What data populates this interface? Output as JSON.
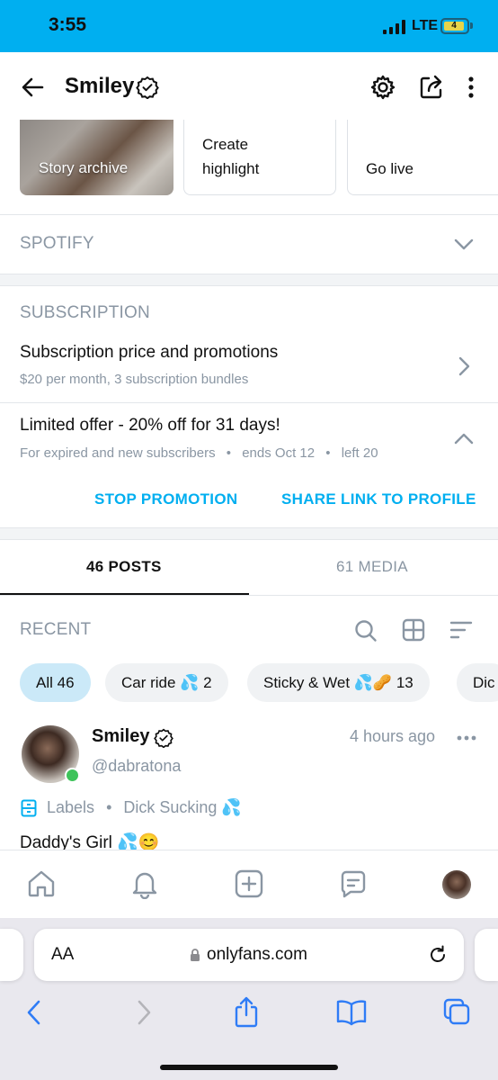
{
  "status_bar": {
    "time": "3:55",
    "network": "LTE",
    "battery": "4"
  },
  "header": {
    "title": "Smiley"
  },
  "stories": {
    "archive_label": "Story archive",
    "create_highlight_label": "Create\nhighlight",
    "go_live_label": "Go live"
  },
  "spotify": {
    "title": "SPOTIFY"
  },
  "subscription": {
    "title": "SUBSCRIPTION",
    "price_title": "Subscription price and promotions",
    "price_sub": "$20 per month, 3 subscription bundles"
  },
  "offer": {
    "title": "Limited offer - 20% off for 31 days!",
    "audience": "For expired and new subscribers",
    "ends": "ends Oct 12",
    "left": "left 20",
    "stop_label": "STOP PROMOTION",
    "share_label": "SHARE LINK TO PROFILE"
  },
  "tabs": [
    {
      "label": "46 POSTS",
      "active": true
    },
    {
      "label": "61 MEDIA",
      "active": false
    }
  ],
  "recent": {
    "title": "RECENT"
  },
  "chips": [
    {
      "label": "All 46"
    },
    {
      "label": "Car ride 💦 2"
    },
    {
      "label": "Sticky & Wet 💦🥜 13"
    },
    {
      "label": "Dic"
    }
  ],
  "post": {
    "name": "Smiley",
    "handle": "@dabratona",
    "time": "4 hours ago",
    "labels_label": "Labels",
    "label_name": "Dick Sucking 💦",
    "text": "Daddy's Girl 💦😊"
  },
  "browser": {
    "url": "onlyfans.com",
    "text_size_label": "AA"
  },
  "colors": {
    "accent": "#00aff0",
    "status_bar": "#00aff0",
    "muted": "#8a96a3",
    "online": "#3ec35a"
  }
}
